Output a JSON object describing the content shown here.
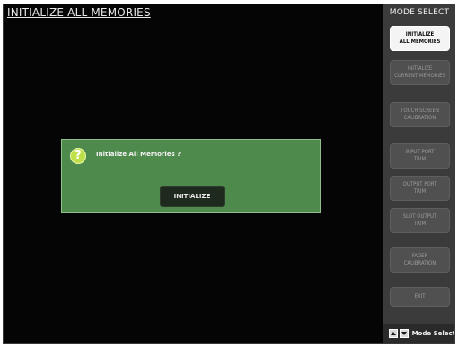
{
  "screen": {
    "title": "INITIALIZE  ALL  MEMORIES"
  },
  "sidebar": {
    "title": "MODE SELECT",
    "items": [
      {
        "line1": "INITIALIZE",
        "line2": "ALL MEMORIES",
        "active": true
      },
      {
        "line1": "INITIALIZE",
        "line2": "CURRENT MEMORIES",
        "active": false
      },
      {
        "line1": "TOUCH SCREEN",
        "line2": "CALIBRATION",
        "active": false
      },
      {
        "line1": "INPUT PORT",
        "line2": "TRIM",
        "active": false
      },
      {
        "line1": "OUTPUT PORT",
        "line2": "TRIM",
        "active": false
      },
      {
        "line1": "SLOT OUTPUT",
        "line2": "TRIM",
        "active": false
      },
      {
        "line1": "FADER",
        "line2": "CALIBRATION",
        "active": false
      },
      {
        "line1": "EXIT",
        "line2": "",
        "active": false
      }
    ],
    "footer_label": "Mode Select"
  },
  "dialog": {
    "icon": "question-icon",
    "icon_glyph": "?",
    "message": "Initialize All Memories ?",
    "button_label": "INITIALIZE"
  },
  "colors": {
    "screen_bg": "#050505",
    "panel_bg": "#3b3b3b",
    "dialog_bg": "#4f8a4d",
    "active_button": "#f4f4f4"
  }
}
